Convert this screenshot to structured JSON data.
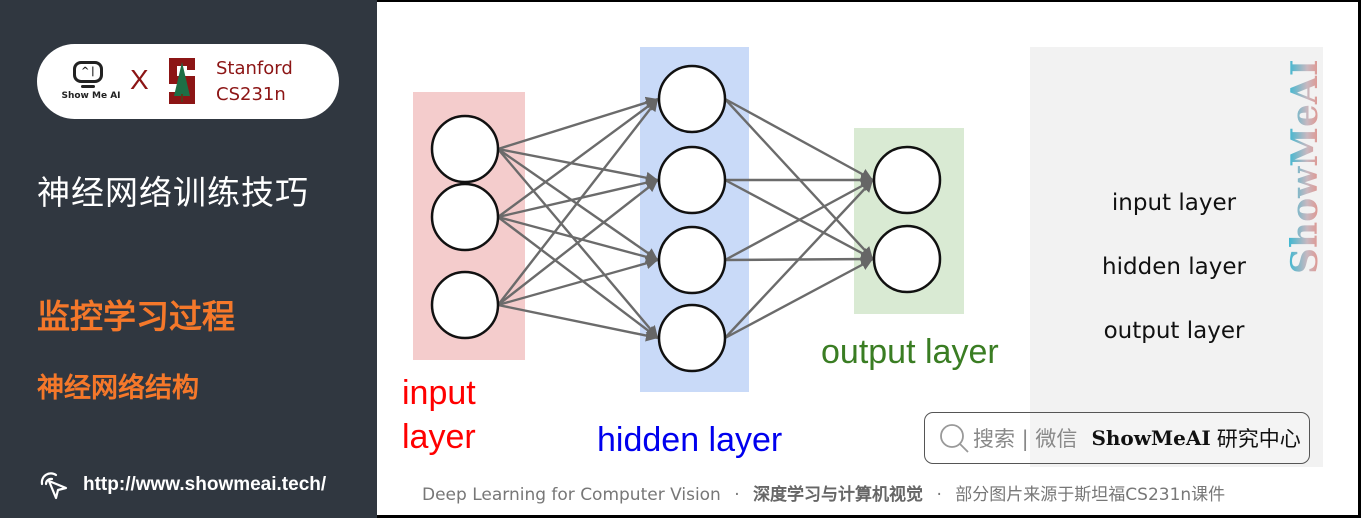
{
  "sidebar": {
    "logo": {
      "showmeai_label": "Show Me AI",
      "cross": "X",
      "partner_line1": "Stanford",
      "partner_line2": "CS231n"
    },
    "title": "神经网络训练技巧",
    "section": "监控学习过程",
    "subsection": "神经网络结构",
    "url": "http://www.showmeai.tech/"
  },
  "diagram": {
    "layers": [
      {
        "name": "input layer",
        "label_lines": [
          "input",
          "layer"
        ],
        "nodes": 3,
        "color": "#ff0000",
        "bg": "#f4cccc"
      },
      {
        "name": "hidden layer",
        "label_lines": [
          "hidden layer"
        ],
        "nodes": 4,
        "color": "#0000ee",
        "bg": "#c9daf8"
      },
      {
        "name": "output layer",
        "label_lines": [
          "output layer"
        ],
        "nodes": 2,
        "color": "#3a7d23",
        "bg": "#d9ead3"
      }
    ],
    "input_label_1": "input",
    "input_label_2": "layer",
    "hidden_label": "hidden layer",
    "output_label": "output layer"
  },
  "legend": {
    "items": [
      "input layer",
      "hidden layer",
      "output layer"
    ],
    "watermark": "ShowMeAI"
  },
  "search": {
    "hint": "搜索 | 微信",
    "brand": "ShowMeAI",
    "brand_suffix": "研究中心"
  },
  "footer": {
    "part1": "Deep Learning for Computer Vision",
    "sep": "·",
    "part2": "深度学习与计算机视觉",
    "part3": "部分图片来源于斯坦福CS231n课件"
  }
}
